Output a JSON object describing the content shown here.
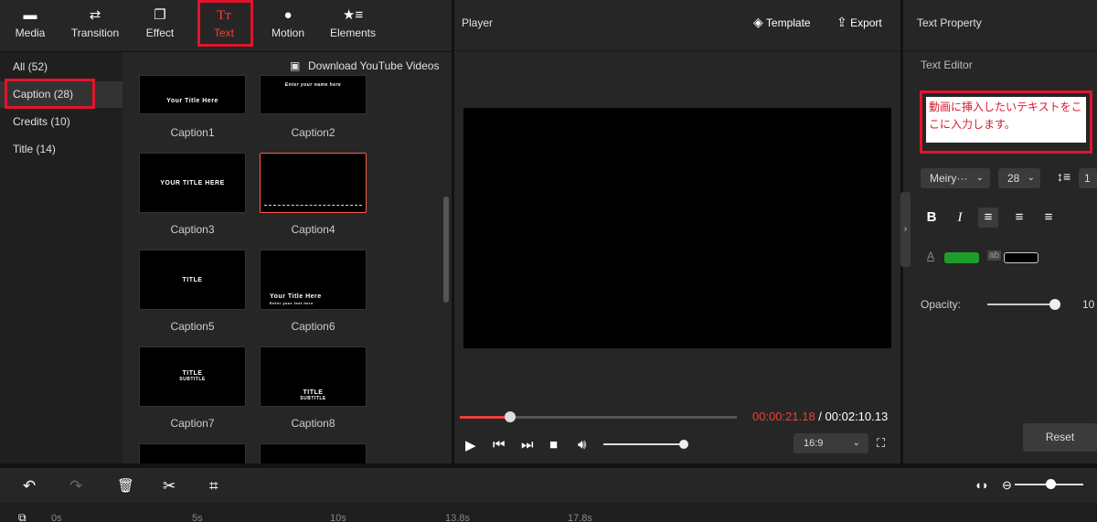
{
  "toolbar": {
    "tabs": [
      {
        "label": "Media",
        "icon": "folder-icon"
      },
      {
        "label": "Transition",
        "icon": "transition-icon"
      },
      {
        "label": "Effect",
        "icon": "effect-icon"
      },
      {
        "label": "Text",
        "icon": "text-icon"
      },
      {
        "label": "Motion",
        "icon": "motion-icon"
      },
      {
        "label": "Elements",
        "icon": "elements-icon"
      }
    ],
    "active": "Text"
  },
  "categories": [
    {
      "label": "All (52)"
    },
    {
      "label": "Caption (28)"
    },
    {
      "label": "Credits (10)"
    },
    {
      "label": "Title (14)"
    }
  ],
  "download_link": "Download YouTube Videos",
  "thumbnails": [
    {
      "caption": "Caption1",
      "preview": "Your  Title Here"
    },
    {
      "caption": "Caption2",
      "preview": "Enter your name here"
    },
    {
      "caption": "Caption3",
      "preview": "YOUR TITLE HERE"
    },
    {
      "caption": "Caption4",
      "preview": ""
    },
    {
      "caption": "Caption5",
      "preview": "TITLE"
    },
    {
      "caption": "Caption6",
      "preview": "Your  Title Here",
      "preview2": "Enter your text here"
    },
    {
      "caption": "Caption7",
      "preview": "TITLE",
      "preview2": "SUBTITLE"
    },
    {
      "caption": "Caption8",
      "preview": "TITLE",
      "preview2": "SUBTITLE"
    }
  ],
  "player": {
    "title": "Player",
    "template_label": "Template",
    "export_label": "Export",
    "time_current": "00:00:21.18",
    "time_separator": " / ",
    "time_total": "00:02:10.13",
    "progress": 0.18,
    "volume": 0.98,
    "aspect_ratio": "16:9"
  },
  "text_property": {
    "title": "Text Property",
    "editor_label": "Text Editor",
    "text_value": "動画に挿入したいテキストをここに入力します。",
    "font": "Meiry···",
    "size": "28",
    "spacing_value": "1",
    "bold": "B",
    "italic": "I",
    "opacity_label": "Opacity:",
    "opacity_value": "10",
    "opacity": 0.98,
    "text_color": "#1f9d2b",
    "bg_color": "#000000",
    "reset_label": "Reset"
  },
  "timeline": {
    "ticks": [
      "0s",
      "5s",
      "10s",
      "13.8s",
      "17.8s"
    ]
  },
  "colors": {
    "accent": "#e0152c",
    "progress": "#e8413a"
  }
}
